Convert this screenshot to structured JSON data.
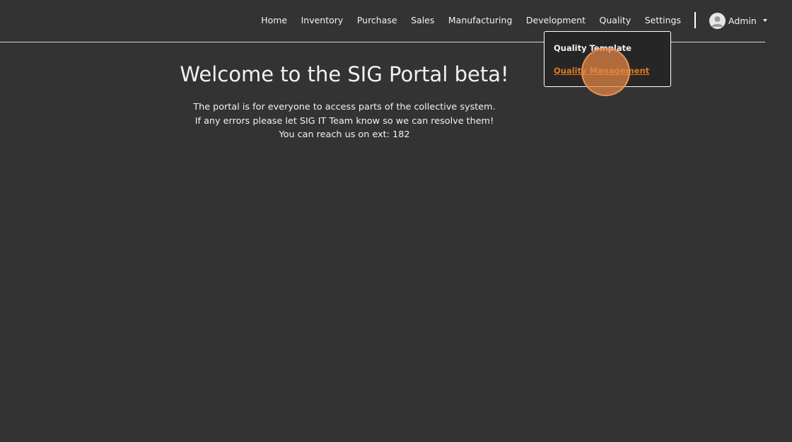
{
  "nav": {
    "items": [
      "Home",
      "Inventory",
      "Purchase",
      "Sales",
      "Manufacturing",
      "Development",
      "Quality",
      "Settings"
    ],
    "user": {
      "name": "Admin",
      "avatar_icon": "user-avatar-icon"
    }
  },
  "dropdown": {
    "items": [
      "Quality Template",
      "Quality Management"
    ]
  },
  "main": {
    "title": "Welcome to the SIG Portal beta!",
    "lines": [
      "The portal is for everyone to access parts of the collective system.",
      "If any errors please let SIG IT Team know so we can resolve them!",
      "You can reach us on ext: 182"
    ]
  },
  "colors": {
    "background": "#333333",
    "dropdown_bg": "#262626",
    "accent": "#e07a1e"
  }
}
